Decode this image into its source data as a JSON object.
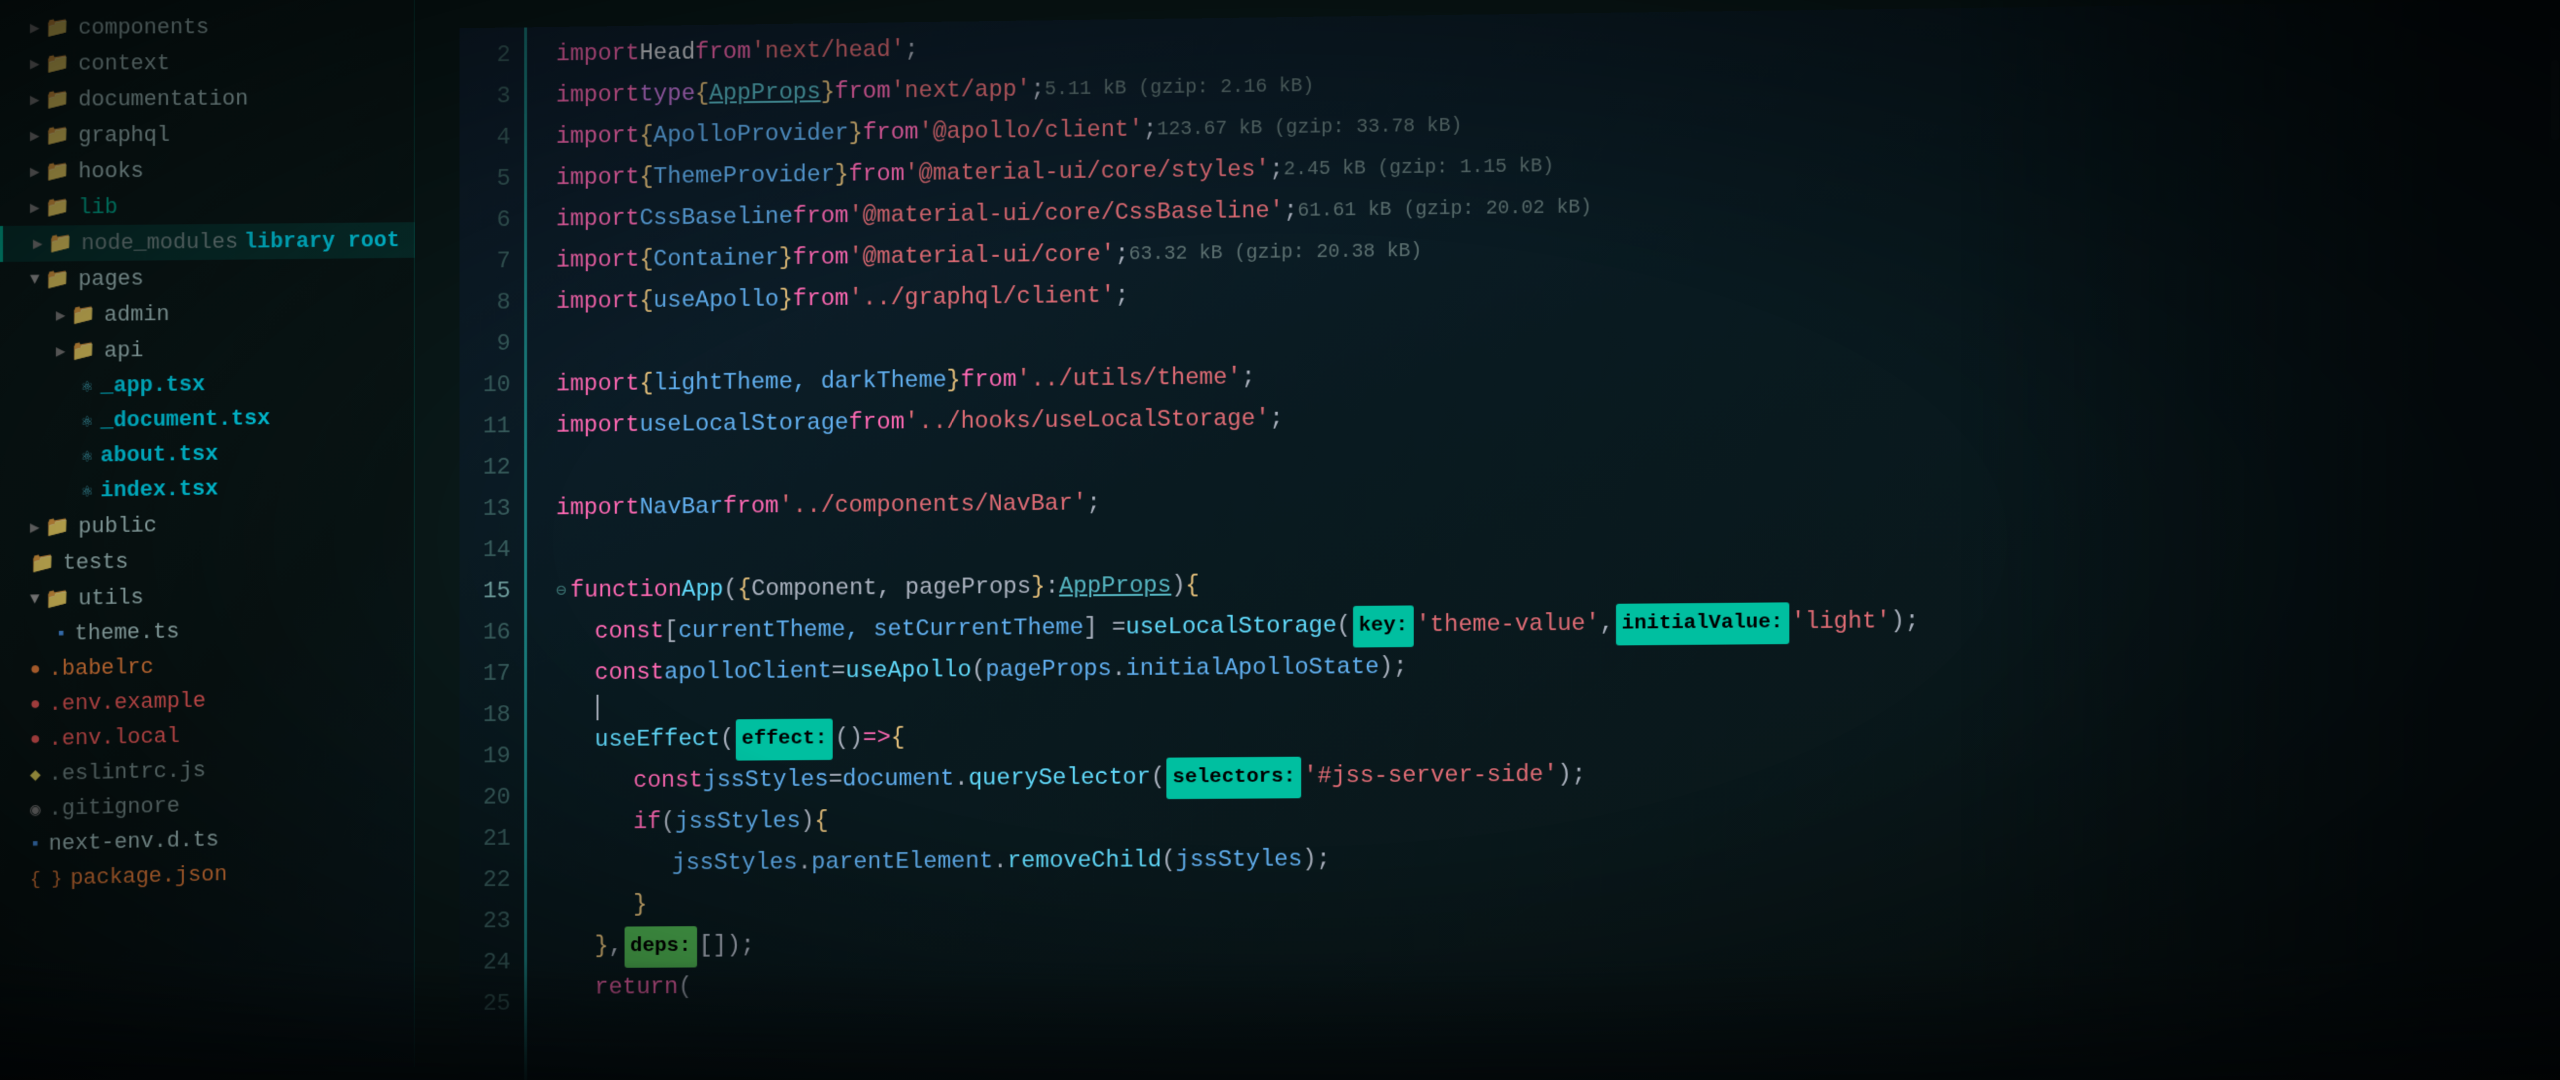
{
  "sidebar": {
    "items": [
      {
        "id": "components",
        "label": "components",
        "indent": 1,
        "type": "folder",
        "icon": "blue",
        "arrow": "▶",
        "open": false
      },
      {
        "id": "context",
        "label": "context",
        "indent": 1,
        "type": "folder",
        "icon": "blue",
        "arrow": "▶",
        "open": false
      },
      {
        "id": "documentation",
        "label": "documentation",
        "indent": 1,
        "type": "folder",
        "icon": "teal",
        "arrow": "▶",
        "open": false
      },
      {
        "id": "graphql",
        "label": "graphql",
        "indent": 1,
        "type": "folder",
        "icon": "pink",
        "arrow": "▶",
        "open": false
      },
      {
        "id": "hooks",
        "label": "hooks",
        "indent": 1,
        "type": "folder",
        "icon": "blue",
        "arrow": "▶",
        "open": false
      },
      {
        "id": "lib",
        "label": "lib",
        "indent": 1,
        "type": "folder",
        "icon": "teal",
        "arrow": "▶",
        "open": false
      },
      {
        "id": "node_modules",
        "label": "node_modules",
        "labelExtra": "library root",
        "indent": 1,
        "type": "folder",
        "icon": "blue",
        "arrow": "▶",
        "open": false,
        "selected": true
      },
      {
        "id": "pages",
        "label": "pages",
        "indent": 1,
        "type": "folder",
        "icon": "teal",
        "arrow": "▼",
        "open": true
      },
      {
        "id": "admin",
        "label": "admin",
        "indent": 2,
        "type": "folder",
        "icon": "cyan",
        "arrow": "▶",
        "open": false
      },
      {
        "id": "api",
        "label": "api",
        "indent": 2,
        "type": "folder",
        "icon": "blue",
        "arrow": "▶",
        "open": false
      },
      {
        "id": "_app.tsx",
        "label": "_app.tsx",
        "indent": 3,
        "type": "file",
        "icon": "tsx"
      },
      {
        "id": "_document.tsx",
        "label": "_document.tsx",
        "indent": 3,
        "type": "file",
        "icon": "tsx"
      },
      {
        "id": "about.tsx",
        "label": "about.tsx",
        "indent": 3,
        "type": "file",
        "icon": "tsx"
      },
      {
        "id": "index.tsx",
        "label": "index.tsx",
        "indent": 3,
        "type": "file",
        "icon": "tsx"
      },
      {
        "id": "public",
        "label": "public",
        "indent": 1,
        "type": "folder",
        "icon": "blue",
        "arrow": "▶",
        "open": false
      },
      {
        "id": "tests",
        "label": "tests",
        "indent": 1,
        "type": "folder",
        "icon": "blue",
        "arrow": "▶",
        "open": false
      },
      {
        "id": "utils",
        "label": "utils",
        "indent": 1,
        "type": "folder",
        "icon": "teal",
        "arrow": "▼",
        "open": true
      },
      {
        "id": "theme.ts",
        "label": "theme.ts",
        "indent": 2,
        "type": "file",
        "icon": "ts"
      },
      {
        "id": ".babelrc",
        "label": ".babelrc",
        "indent": 1,
        "type": "file",
        "icon": "babelrc"
      },
      {
        "id": ".env.example",
        "label": ".env.example",
        "indent": 1,
        "type": "file",
        "icon": "env"
      },
      {
        "id": ".env.local",
        "label": ".env.local",
        "indent": 1,
        "type": "file",
        "icon": "env"
      },
      {
        "id": ".eslintrc.js",
        "label": ".eslintrc.js",
        "indent": 1,
        "type": "file",
        "icon": "js"
      },
      {
        "id": ".gitignore",
        "label": ".gitignore",
        "indent": 1,
        "type": "file",
        "icon": "gitignore"
      },
      {
        "id": "next-env.d.ts",
        "label": "next-env.d.ts",
        "indent": 1,
        "type": "file",
        "icon": "ts"
      },
      {
        "id": "package.json",
        "label": "package.json",
        "indent": 1,
        "type": "file",
        "icon": "json"
      }
    ]
  },
  "editor": {
    "lines": [
      {
        "num": 2,
        "content": "import Head from 'next/head';"
      },
      {
        "num": 3,
        "content": "import type { AppProps } from 'next/app';  5.11 kB (gzip: 2.16 kB)"
      },
      {
        "num": 4,
        "content": "import { ApolloProvider } from '@apollo/client';  123.67 kB (gzip: 33.78 kB)"
      },
      {
        "num": 5,
        "content": "import { ThemeProvider } from '@material-ui/core/styles';  2.45 kB (gzip: 1.15 kB)"
      },
      {
        "num": 6,
        "content": "import CssBaseline from '@material-ui/core/CssBaseline';  61.61 kB (gzip: 20.02 kB)"
      },
      {
        "num": 7,
        "content": "import { Container } from '@material-ui/core';  63.32 kB (gzip: 20.38 kB)"
      },
      {
        "num": 8,
        "content": "import { useApollo } from '../graphql/client';"
      },
      {
        "num": 9,
        "content": ""
      },
      {
        "num": 10,
        "content": "import { lightTheme, darkTheme } from '../utils/theme';"
      },
      {
        "num": 11,
        "content": "import useLocalStorage from '../hooks/useLocalStorage';"
      },
      {
        "num": 12,
        "content": ""
      },
      {
        "num": 13,
        "content": "import NavBar from '../components/NavBar';"
      },
      {
        "num": 14,
        "content": ""
      },
      {
        "num": 15,
        "content": "function App({ Component, pageProps }: AppProps) {"
      },
      {
        "num": 16,
        "content": "  const [currentTheme, setCurrentTheme] = useLocalStorage( key: 'theme-value',  initialValue: 'light');"
      },
      {
        "num": 17,
        "content": "  const apolloClient = useApollo(pageProps.initialApolloState);"
      },
      {
        "num": 18,
        "content": ""
      },
      {
        "num": 19,
        "content": "  useEffect( effect: () => {"
      },
      {
        "num": 20,
        "content": "    const jssStyles = document.querySelector( selectors: '#jss-server-side');"
      },
      {
        "num": 21,
        "content": "    if (jssStyles) {"
      },
      {
        "num": 22,
        "content": "      jssStyles.parentElement.removeChild(jssStyles);"
      },
      {
        "num": 23,
        "content": "    }"
      },
      {
        "num": 24,
        "content": "  },  deps: []);"
      },
      {
        "num": 25,
        "content": "  return ("
      }
    ]
  }
}
